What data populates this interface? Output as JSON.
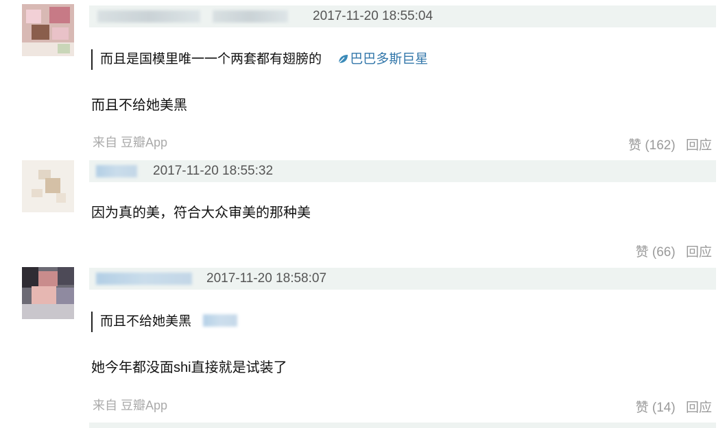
{
  "comments": [
    {
      "timestamp": "2017-11-20 18:55:04",
      "quote": {
        "text": "而且是国模里唯一一个两套都有翅膀的",
        "author": "巴巴多斯巨星"
      },
      "text": "而且不给她美黑",
      "source": "来自 豆瓣App",
      "like": "赞 (162)",
      "reply": "回应"
    },
    {
      "timestamp": "2017-11-20 18:55:32",
      "text": "因为真的美，符合大众审美的那种美",
      "like": "赞 (66)",
      "reply": "回应"
    },
    {
      "author_name": "巴巴多斯巨星",
      "timestamp": "2017-11-20 18:58:07",
      "quote": {
        "text": "而且不给她美黑"
      },
      "text": "她今年都没面shi直接就是试装了",
      "source": "来自 豆瓣App",
      "like": "赞 (14)",
      "reply": "回应"
    }
  ],
  "colors": {
    "header_bg": "#eef3f1",
    "link": "#3377aa",
    "muted": "#9a9a9a"
  }
}
